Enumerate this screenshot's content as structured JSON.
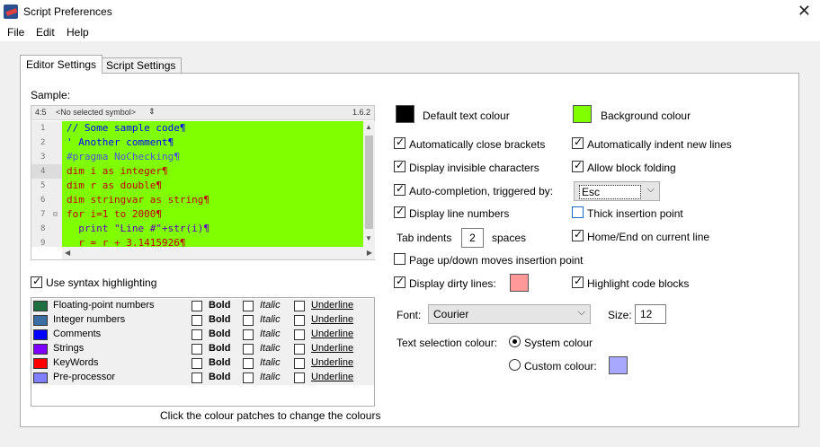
{
  "window": {
    "title": "Script Preferences"
  },
  "menu": {
    "file": "File",
    "edit": "Edit",
    "help": "Help"
  },
  "tabs": {
    "editor": "Editor Settings",
    "script": "Script Settings"
  },
  "sample_label": "Sample:",
  "editor": {
    "cursor_pos": "4:5",
    "symbol": "<No selected symbol>",
    "version": "1.6.2",
    "line_numbers": [
      "1",
      "2",
      "3",
      "4",
      "5",
      "6",
      "7",
      "8",
      "9"
    ],
    "lines": [
      "// Some sample code¶",
      "' Another comment¶",
      "#pragma NoChecking¶",
      "dim i as integer¶",
      "dim r as double¶",
      "dim stringvar as string¶",
      "for i=1 to 2000¶",
      "  print \"Line #\"+str(i)¶",
      "  r = r + 3.1415926¶"
    ],
    "colors": {
      "background": "#80ff00",
      "comment": "#0000ff",
      "preprocessor": "#8080ff",
      "keyword": "#ff0000",
      "string": "#8000ff",
      "number": "#ff0000"
    }
  },
  "syntax": {
    "use_label": "Use syntax highlighting",
    "bold": "Bold",
    "italic": "Italic",
    "underline": "Underline",
    "items": [
      {
        "name": "Floating-point numbers",
        "color": "#1e7040"
      },
      {
        "name": "Integer numbers",
        "color": "#3a6ea5"
      },
      {
        "name": "Comments",
        "color": "#0000ff"
      },
      {
        "name": "Strings",
        "color": "#8000ff"
      },
      {
        "name": "KeyWords",
        "color": "#ff0000"
      },
      {
        "name": "Pre-processor",
        "color": "#8080ff"
      }
    ],
    "hint": "Click the colour patches to change the colours"
  },
  "colours": {
    "default_text_label": "Default text colour",
    "default_text_color": "#000000",
    "background_label": "Background colour",
    "background_color": "#80ff00"
  },
  "options": {
    "close_brackets": "Automatically close brackets",
    "indent_lines": "Automatically indent new lines",
    "invisible_chars": "Display invisible characters",
    "block_folding": "Allow block folding",
    "autocomplete": "Auto-completion, triggered by:",
    "autocomplete_key": "Esc",
    "line_numbers": "Display line numbers",
    "thick_cursor": "Thick insertion point",
    "tab_indents": "Tab indents",
    "tab_value": "2",
    "spaces": "spaces",
    "home_end": "Home/End on current line",
    "page_updown": "Page up/down moves insertion point",
    "dirty_lines": "Display dirty lines:",
    "dirty_color": "#ff9999",
    "highlight_blocks": "Highlight code blocks"
  },
  "font": {
    "label": "Font:",
    "value": "Courier",
    "size_label": "Size:",
    "size_value": "12"
  },
  "selection": {
    "label": "Text selection colour:",
    "system": "System colour",
    "custom": "Custom colour:",
    "custom_color": "#a8a8ff"
  }
}
